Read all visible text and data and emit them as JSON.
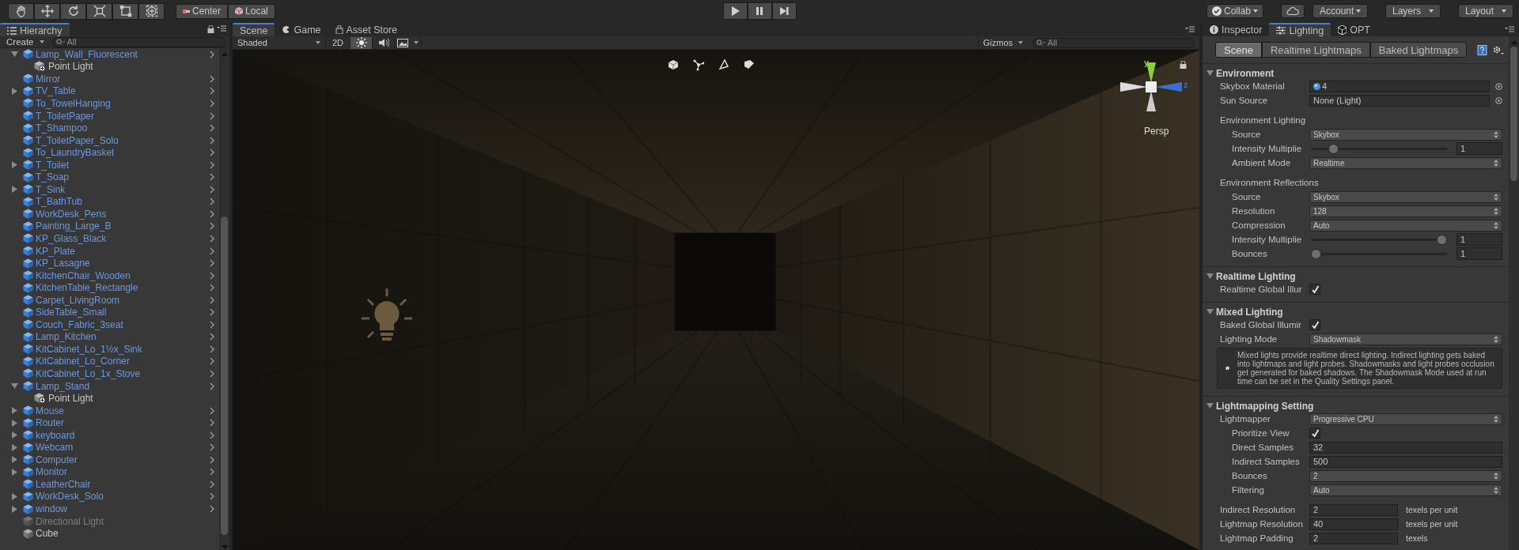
{
  "toolbar": {
    "pivot_buttons": [
      {
        "label": "Center",
        "kind": "pivot"
      },
      {
        "label": "Local",
        "kind": "space"
      }
    ],
    "right_buttons": [
      {
        "label": "Collab",
        "kind": "collab"
      },
      {
        "kind": "cloud"
      },
      {
        "label": "Account",
        "kind": "menu"
      },
      {
        "label": "Layers",
        "kind": "menu"
      },
      {
        "label": "Layout",
        "kind": "menu"
      }
    ]
  },
  "hierarchy": {
    "tab": {
      "label": "Hierarchy",
      "selected": true
    },
    "create_button": "Create",
    "search_placeholder": "All",
    "items": [
      {
        "label": "Lamp_Wall_Fluorescent",
        "kind": "prefab",
        "expanded": true,
        "children": [
          {
            "label": "Point Light",
            "kind": "light"
          }
        ]
      },
      {
        "label": "Mirror",
        "kind": "prefab"
      },
      {
        "label": "TV_Table",
        "kind": "prefab",
        "expanded": false
      },
      {
        "label": "To_TowelHanging",
        "kind": "prefab"
      },
      {
        "label": "T_ToiletPaper",
        "kind": "prefab"
      },
      {
        "label": "T_Shampoo",
        "kind": "prefab"
      },
      {
        "label": "T_ToiletPaper_Solo",
        "kind": "prefab"
      },
      {
        "label": "To_LaundryBasket",
        "kind": "prefab"
      },
      {
        "label": "T_Toilet",
        "kind": "prefab",
        "expanded": false
      },
      {
        "label": "T_Soap",
        "kind": "prefab"
      },
      {
        "label": "T_Sink",
        "kind": "prefab",
        "expanded": false
      },
      {
        "label": "T_BathTub",
        "kind": "prefab"
      },
      {
        "label": "WorkDesk_Pens",
        "kind": "prefab"
      },
      {
        "label": "Painting_Large_B",
        "kind": "prefab"
      },
      {
        "label": "KP_Glass_Black",
        "kind": "prefab"
      },
      {
        "label": "KP_Plate",
        "kind": "prefab"
      },
      {
        "label": "KP_Lasagne",
        "kind": "prefab"
      },
      {
        "label": "KitchenChair_Wooden",
        "kind": "prefab"
      },
      {
        "label": "KitchenTable_Rectangle",
        "kind": "prefab"
      },
      {
        "label": "Carpet_LivingRoom",
        "kind": "prefab"
      },
      {
        "label": "SideTable_Small",
        "kind": "prefab"
      },
      {
        "label": "Couch_Fabric_3seat",
        "kind": "prefab"
      },
      {
        "label": "Lamp_Kitchen",
        "kind": "prefab"
      },
      {
        "label": "KitCabinet_Lo_1½x_Sink",
        "kind": "prefab"
      },
      {
        "label": "KitCabinet_Lo_Corner",
        "kind": "prefab"
      },
      {
        "label": "KitCabinet_Lo_1x_Stove",
        "kind": "prefab"
      },
      {
        "label": "Lamp_Stand",
        "kind": "prefab",
        "expanded": true,
        "children": [
          {
            "label": "Point Light",
            "kind": "light"
          }
        ]
      },
      {
        "label": "Mouse",
        "kind": "prefab",
        "expanded": false
      },
      {
        "label": "Router",
        "kind": "prefab",
        "expanded": false
      },
      {
        "label": "keyboard",
        "kind": "prefab",
        "expanded": false
      },
      {
        "label": "Webcam",
        "kind": "prefab",
        "expanded": false
      },
      {
        "label": "Computer",
        "kind": "prefab",
        "expanded": false
      },
      {
        "label": "Monitor",
        "kind": "prefab",
        "expanded": false
      },
      {
        "label": "LeatherChair",
        "kind": "prefab"
      },
      {
        "label": "WorkDesk_Solo",
        "kind": "prefab",
        "expanded": false
      },
      {
        "label": "window",
        "kind": "prefab",
        "expanded": false
      },
      {
        "label": "Directional Light",
        "kind": "inactive"
      },
      {
        "label": "Cube",
        "kind": "object"
      }
    ]
  },
  "scene": {
    "tabs": [
      {
        "label": "Scene",
        "kind": "scene",
        "selected": true
      },
      {
        "label": "Game",
        "kind": "game",
        "selected": false
      },
      {
        "label": "Asset Store",
        "kind": "store",
        "selected": false
      }
    ],
    "shading_mode": "Shaded",
    "mode_2d": {
      "label": "2D",
      "on": false
    },
    "lighting_toggle": {
      "on": true
    },
    "audio_toggle": {
      "on": false
    },
    "gizmos_button": "Gizmos",
    "search_placeholder": "All",
    "gizmo_labels": {
      "y": "y",
      "z": "z",
      "projection": "Persp"
    }
  },
  "lighting": {
    "window_tabs": [
      {
        "label": "Inspector",
        "kind": "info",
        "selected": false
      },
      {
        "label": "Lighting",
        "kind": "lighting",
        "selected": true
      },
      {
        "label": "OPT",
        "kind": "opt",
        "selected": false
      }
    ],
    "tabs": [
      {
        "label": "Scene",
        "selected": true
      },
      {
        "label": "Realtime Lightmaps",
        "selected": false
      },
      {
        "label": "Baked Lightmaps",
        "selected": false
      }
    ],
    "sections": [
      {
        "title": "Environment",
        "expanded": true,
        "rows": [
          {
            "kind": "object",
            "label": "Skybox Material",
            "value": "4",
            "asset": true
          },
          {
            "kind": "object",
            "label": "Sun Source",
            "value": "None (Light)",
            "asset": false
          },
          {
            "kind": "group",
            "label": "Environment Lighting",
            "children": [
              {
                "kind": "dropdown",
                "label": "Source",
                "value": "Skybox"
              },
              {
                "kind": "slider",
                "label": "Intensity Multiplie",
                "level": 0.14,
                "value": "1"
              },
              {
                "kind": "dropdown",
                "label": "Ambient Mode",
                "value": "Realtime"
              }
            ]
          },
          {
            "kind": "group",
            "label": "Environment Reflections",
            "children": [
              {
                "kind": "dropdown",
                "label": "Source",
                "value": "Skybox"
              },
              {
                "kind": "dropdown",
                "label": "Resolution",
                "value": "128"
              },
              {
                "kind": "dropdown",
                "label": "Compression",
                "value": "Auto"
              },
              {
                "kind": "slider",
                "label": "Intensity Multiplie",
                "level": 1,
                "value": "1"
              },
              {
                "kind": "slider",
                "label": "Bounces",
                "level": 0,
                "value": "1"
              }
            ]
          }
        ]
      },
      {
        "title": "Realtime Lighting",
        "expanded": true,
        "rows": [
          {
            "kind": "checkbox",
            "label": "Realtime Global Illur",
            "checked": true
          }
        ]
      },
      {
        "title": "Mixed Lighting",
        "expanded": true,
        "rows": [
          {
            "kind": "checkbox",
            "label": "Baked Global Illumir",
            "checked": true
          },
          {
            "kind": "dropdown",
            "label": "Lighting Mode",
            "value": "Shadowmask"
          },
          {
            "kind": "help",
            "text": "Mixed lights provide realtime direct lighting. Indirect lighting gets baked into lightmaps and light probes. Shadowmasks and light probes occlusion get generated for baked shadows. The Shadowmask Mode used at run time can be set in the Quality Settings panel."
          }
        ]
      },
      {
        "title": "Lightmapping Setting",
        "expanded": true,
        "rows": [
          {
            "kind": "dropdown",
            "label": "Lightmapper",
            "value": "Progressive CPU",
            "children": [
              {
                "kind": "checkbox",
                "label": "Prioritize View",
                "checked": true
              },
              {
                "kind": "field",
                "label": "Direct Samples",
                "value": "32"
              },
              {
                "kind": "field",
                "label": "Indirect Samples",
                "value": "500"
              },
              {
                "kind": "dropdown",
                "label": "Bounces",
                "value": "2"
              },
              {
                "kind": "dropdown",
                "label": "Filtering",
                "value": "Auto"
              }
            ]
          },
          {
            "kind": "unit_field",
            "label": "Indirect Resolution",
            "value": "2",
            "unit": "texels per unit"
          },
          {
            "kind": "unit_field",
            "label": "Lightmap Resolution",
            "value": "40",
            "unit": "texels per unit"
          },
          {
            "kind": "unit_field",
            "label": "Lightmap Padding",
            "value": "2",
            "unit": "texels"
          }
        ]
      }
    ]
  }
}
